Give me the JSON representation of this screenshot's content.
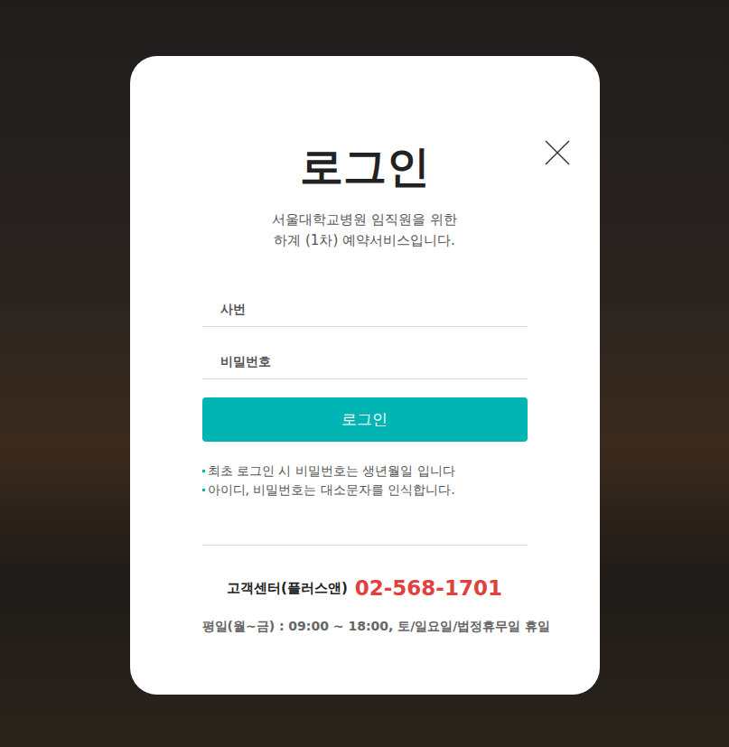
{
  "modal": {
    "title": "로그인",
    "subtitle": [
      "서울대학교병원 임직원을 위한",
      "하계 (1차) 예약서비스입니다."
    ],
    "fields": [
      {
        "placeholder": "사번"
      },
      {
        "placeholder": "비밀번호"
      }
    ],
    "submit": "로그인",
    "notes": [
      "최초 로그인 시 비밀번호는 생년월일 입니다",
      "아이디, 비밀번호는 대소문자를 인식합니다."
    ],
    "support": {
      "label": "고객센터(플러스앤)",
      "phone": "02-568-1701",
      "hours": "평일(월~금) : 09:00 ~ 18:00, 토/일요일/법정휴무일 휴일"
    }
  }
}
